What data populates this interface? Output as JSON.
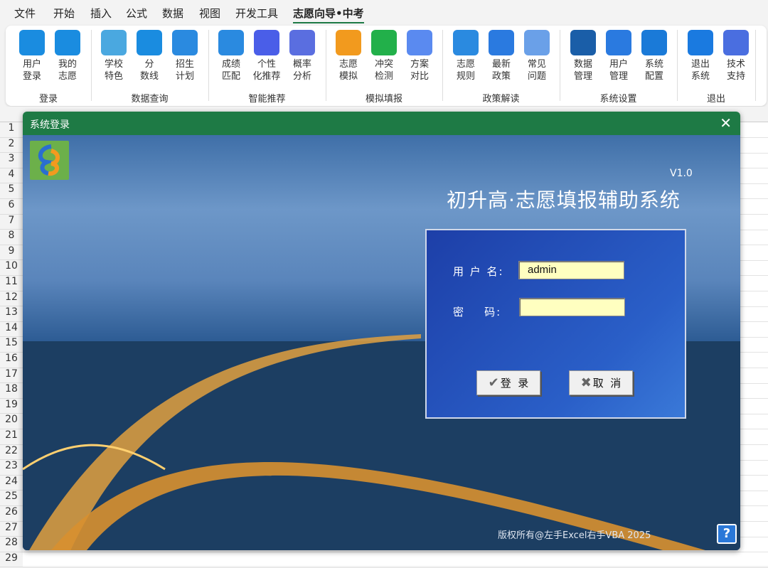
{
  "tabs": [
    "文件",
    "开始",
    "插入",
    "公式",
    "数据",
    "视图",
    "开发工具",
    "志愿向导•中考"
  ],
  "active_tab": 7,
  "ribbon": {
    "groups": [
      {
        "label": "登录",
        "buttons": [
          {
            "l1": "用户",
            "l2": "登录",
            "icon": "login-arrow-icon",
            "color": "#1a8ce0"
          },
          {
            "l1": "我的",
            "l2": "志愿",
            "icon": "document-heart-icon",
            "color": "#1a8ce0"
          }
        ]
      },
      {
        "label": "数据查询",
        "buttons": [
          {
            "l1": "学校",
            "l2": "特色",
            "icon": "school-icon",
            "color": "#4aa8e0"
          },
          {
            "l1": "分",
            "l2": "数线",
            "icon": "score-line-icon",
            "color": "#1a8ce0"
          },
          {
            "l1": "招生",
            "l2": "计划",
            "icon": "notebook-icon",
            "color": "#2a8ae0"
          }
        ]
      },
      {
        "label": "智能推荐",
        "buttons": [
          {
            "l1": "成绩",
            "l2": "匹配",
            "icon": "score-checklist-icon",
            "color": "#2a8ae0"
          },
          {
            "l1": "个性",
            "l2": "化推荐",
            "icon": "puzzle-icon",
            "color": "#4a5ee8"
          },
          {
            "l1": "概率",
            "l2": "分析",
            "icon": "percent-chart-icon",
            "color": "#5a6ee0"
          }
        ]
      },
      {
        "label": "模拟填报",
        "buttons": [
          {
            "l1": "志愿",
            "l2": "模拟",
            "icon": "edit-form-icon",
            "color": "#f29a1e"
          },
          {
            "l1": "冲突",
            "l2": "检测",
            "icon": "conflict-icon",
            "color": "#22b04a"
          },
          {
            "l1": "方案",
            "l2": "对比",
            "icon": "pk-icon",
            "color": "#5a8af0"
          }
        ]
      },
      {
        "label": "政策解读",
        "buttons": [
          {
            "l1": "志愿",
            "l2": "规则",
            "icon": "rules-icon",
            "color": "#2a8ae0"
          },
          {
            "l1": "最新",
            "l2": "政策",
            "icon": "policy-book-icon",
            "color": "#2a7ae0"
          },
          {
            "l1": "常见",
            "l2": "问题",
            "icon": "question-icon",
            "color": "#6aa0e8"
          }
        ]
      },
      {
        "label": "系统设置",
        "buttons": [
          {
            "l1": "数据",
            "l2": "管理",
            "icon": "database-gear-icon",
            "color": "#1a5ea8"
          },
          {
            "l1": "用户",
            "l2": "管理",
            "icon": "user-gear-icon",
            "color": "#2a7ae0"
          },
          {
            "l1": "系统",
            "l2": "配置",
            "icon": "monitor-gear-icon",
            "color": "#1a7ad8"
          }
        ]
      },
      {
        "label": "退出",
        "buttons": [
          {
            "l1": "退出",
            "l2": "系统",
            "icon": "logout-icon",
            "color": "#1a7ae0"
          },
          {
            "l1": "技术",
            "l2": "支持",
            "icon": "graduation-cap-icon",
            "color": "#4a6ee0"
          }
        ]
      }
    ]
  },
  "rows": [
    "1",
    "2",
    "3",
    "4",
    "5",
    "6",
    "7",
    "8",
    "9",
    "10",
    "11",
    "12",
    "13",
    "14",
    "15",
    "16",
    "17",
    "18",
    "19",
    "20",
    "21",
    "22",
    "23",
    "24",
    "25",
    "26",
    "27",
    "28",
    "29"
  ],
  "dialog": {
    "title": "系统登录",
    "version": "V1.0",
    "app_title": "初升高·志愿填报辅助系统",
    "username_label": "用 户 名:",
    "username_value": "admin",
    "password_label": "密    码:",
    "password_value": "",
    "login_label": "登  录",
    "cancel_label": "取  消",
    "copyright": "版权所有@左手Excel右手VBA 2025",
    "help": "?"
  }
}
